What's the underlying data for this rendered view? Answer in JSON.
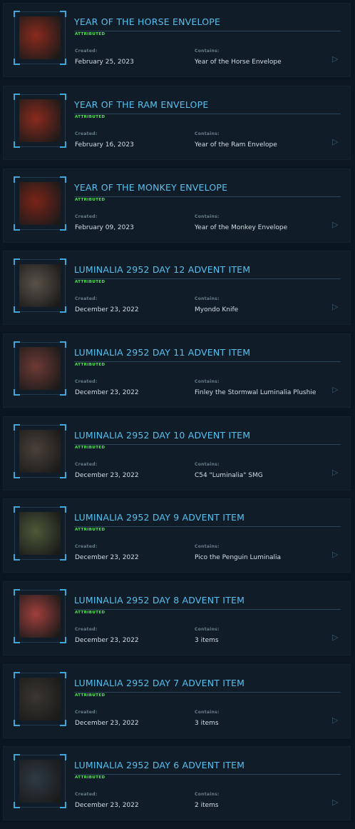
{
  "labels": {
    "created": "Created:",
    "contains": "Contains:"
  },
  "items": [
    {
      "title": "YEAR OF THE HORSE ENVELOPE",
      "status": "ATTRIBUTED",
      "created": "February 25, 2023",
      "contains": "Year of the Horse Envelope",
      "thumb_icon": "red-envelope-image",
      "thumb_color": "#8a2a1c"
    },
    {
      "title": "YEAR OF THE RAM ENVELOPE",
      "status": "ATTRIBUTED",
      "created": "February 16, 2023",
      "contains": "Year of the Ram Envelope",
      "thumb_icon": "red-envelope-image",
      "thumb_color": "#8a2a1c"
    },
    {
      "title": "YEAR OF THE MONKEY ENVELOPE",
      "status": "ATTRIBUTED",
      "created": "February 09, 2023",
      "contains": "Year of the Monkey Envelope",
      "thumb_icon": "red-envelope-image",
      "thumb_color": "#7a2418"
    },
    {
      "title": "LUMINALIA 2952 DAY 12 ADVENT ITEM",
      "status": "ATTRIBUTED",
      "created": "December 23, 2022",
      "contains": "Myondo Knife",
      "thumb_icon": "knife-image",
      "thumb_color": "#5a5248"
    },
    {
      "title": "LUMINALIA 2952 DAY 11 ADVENT ITEM",
      "status": "ATTRIBUTED",
      "created": "December 23, 2022",
      "contains": "Finley the Stormwal Luminalia Plushie",
      "thumb_icon": "plushie-image",
      "thumb_color": "#6e3a34"
    },
    {
      "title": "LUMINALIA 2952 DAY 10 ADVENT ITEM",
      "status": "ATTRIBUTED",
      "created": "December 23, 2022",
      "contains": "C54 \"Luminalia\" SMG",
      "thumb_icon": "smg-image",
      "thumb_color": "#4a4038"
    },
    {
      "title": "LUMINALIA 2952 DAY 9 ADVENT ITEM",
      "status": "ATTRIBUTED",
      "created": "December 23, 2022",
      "contains": "Pico the Penguin Luminalia",
      "thumb_icon": "penguin-plushie-image",
      "thumb_color": "#4c5a38"
    },
    {
      "title": "LUMINALIA 2952 DAY 8 ADVENT ITEM",
      "status": "ATTRIBUTED",
      "created": "December 23, 2022",
      "contains": "3 items",
      "thumb_icon": "outfit-image",
      "thumb_color": "#a0403c"
    },
    {
      "title": "LUMINALIA 2952 DAY 7 ADVENT ITEM",
      "status": "ATTRIBUTED",
      "created": "December 23, 2022",
      "contains": "3 items",
      "thumb_icon": "weapons-rack-image",
      "thumb_color": "#3a3630"
    },
    {
      "title": "LUMINALIA 2952 DAY 6 ADVENT ITEM",
      "status": "ATTRIBUTED",
      "created": "December 23, 2022",
      "contains": "2 items",
      "thumb_icon": "ship-image",
      "thumb_color": "#2e3a44"
    }
  ]
}
